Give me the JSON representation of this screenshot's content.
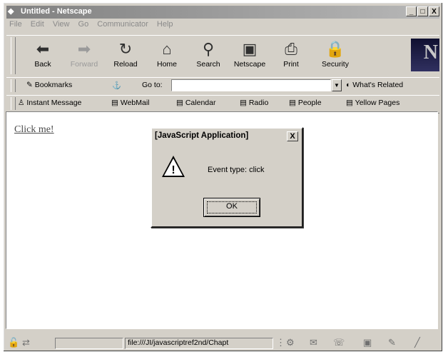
{
  "window": {
    "title": "Untitled - Netscape",
    "min_label": "_",
    "max_label": "□",
    "close_label": "X"
  },
  "menu": [
    "File",
    "Edit",
    "View",
    "Go",
    "Communicator",
    "Help"
  ],
  "nav_toolbar": {
    "buttons": [
      {
        "label": "Back",
        "icon": "back-arrow-icon",
        "glyph": "⬅"
      },
      {
        "label": "Forward",
        "icon": "forward-arrow-icon",
        "glyph": "➡"
      },
      {
        "label": "Reload",
        "icon": "reload-icon",
        "glyph": "↻"
      },
      {
        "label": "Home",
        "icon": "home-icon",
        "glyph": "⌂"
      },
      {
        "label": "Search",
        "icon": "search-icon",
        "glyph": "⚲"
      },
      {
        "label": "Netscape",
        "icon": "netscape-icon",
        "glyph": "▣"
      },
      {
        "label": "Print",
        "icon": "print-icon",
        "glyph": "⎙"
      },
      {
        "label": "Security",
        "icon": "lock-icon",
        "glyph": "🔒"
      }
    ],
    "logo": "N"
  },
  "location_bar": {
    "bookmarks_label": "Bookmarks",
    "goto_label": "Go to:",
    "url_value": "",
    "whats_related": "What's Related"
  },
  "personal_toolbar": {
    "items": [
      "Instant Message",
      "WebMail",
      "Calendar",
      "Radio",
      "People",
      "Yellow Pages"
    ]
  },
  "content": {
    "link_text": "Click me!"
  },
  "dialog": {
    "title": "[JavaScript Application]",
    "message": "Event type: click",
    "ok_label": "OK",
    "close_label": "X"
  },
  "statusbar": {
    "text": "file:///JI/javascriptref2nd/Chapt"
  }
}
